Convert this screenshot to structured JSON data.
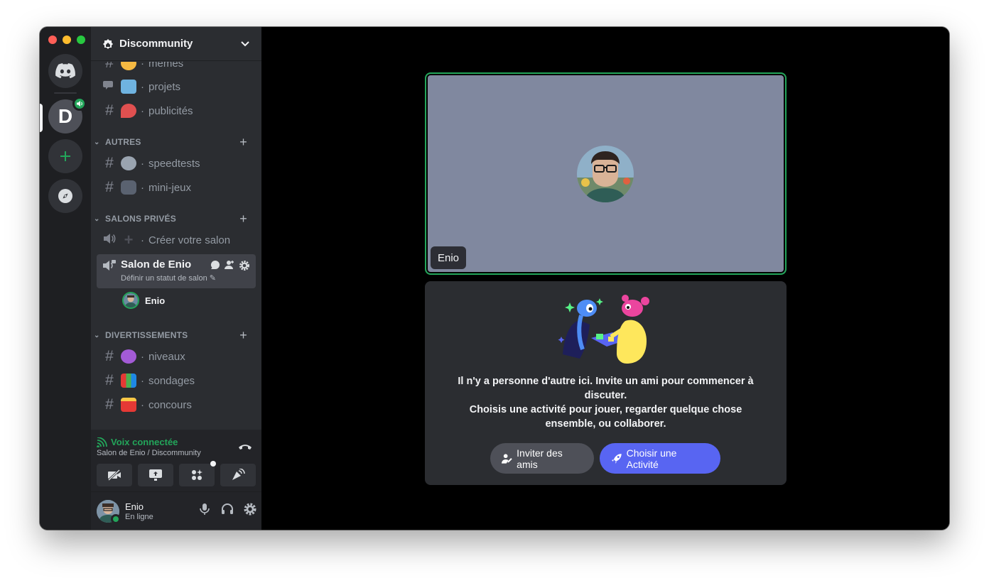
{
  "server": {
    "name": "Discommunity"
  },
  "rail": {
    "active_server_initial": "D"
  },
  "channels": {
    "top": [
      {
        "name": "memes",
        "emoji_color": "#f5b942",
        "icon": "hash"
      },
      {
        "name": "projets",
        "emoji_color": "#6fb3e0",
        "icon": "forum"
      },
      {
        "name": "publicités",
        "emoji_color": "#e05050",
        "icon": "hash"
      }
    ],
    "categories": [
      {
        "label": "AUTRES",
        "items": [
          {
            "name": "speedtests",
            "emoji_color": "#9aa4b0"
          },
          {
            "name": "mini-jeux",
            "emoji_color": "#5a6270"
          }
        ]
      },
      {
        "label": "SALONS PRIVÉS",
        "items": [
          {
            "name": "Créer votre salon",
            "emoji_color": "#4e5058"
          }
        ]
      },
      {
        "label": "DIVERTISSEMENTS",
        "items": [
          {
            "name": "niveaux",
            "emoji_color": "#a35bd6"
          },
          {
            "name": "sondages",
            "emoji_color": "#4caf50"
          },
          {
            "name": "concours",
            "emoji_color": "#e53935"
          }
        ]
      }
    ],
    "separator": "·"
  },
  "active_channel": {
    "title": "Salon de Enio",
    "status_placeholder": "Définir un statut de salon"
  },
  "voice_members": [
    {
      "name": "Enio"
    }
  ],
  "voice_panel": {
    "status": "Voix connectée",
    "location": "Salon de Enio / Discommunity"
  },
  "user": {
    "name": "Enio",
    "status": "En ligne"
  },
  "stage": {
    "tile_name": "Enio",
    "empty_line1": "Il n'y a personne d'autre ici. Invite un ami pour commencer à discuter.",
    "empty_line2": "Choisis une activité pour jouer, regarder quelque chose ensemble, ou collaborer.",
    "invite_label": "Inviter des amis",
    "activity_label": "Choisir une Activité"
  },
  "colors": {
    "accent": "#5865f2",
    "online": "#23a55a",
    "tile_bg": "#80889f"
  }
}
